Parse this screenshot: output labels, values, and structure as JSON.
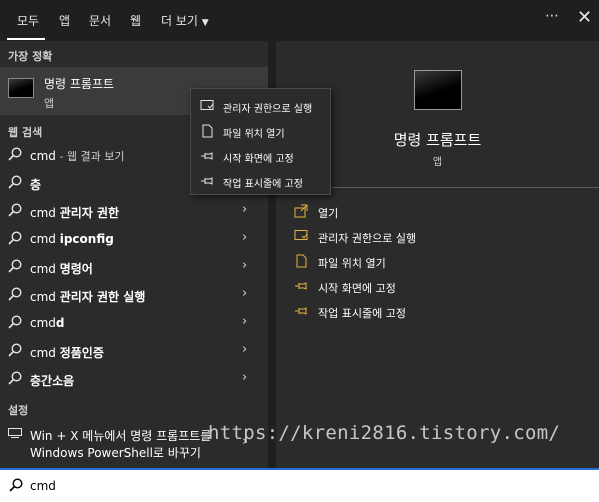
{
  "topbar": {
    "tabs": [
      "모두",
      "앱",
      "문서",
      "웹",
      "더 보기"
    ],
    "more_label": "⋯",
    "close_label": "✕"
  },
  "left": {
    "best_match_header": "가장 정확",
    "best_match": {
      "title": "명령 프롬프트",
      "subtitle": "앱"
    },
    "web_header": "웹 검색",
    "web_items": [
      {
        "prefix": "cmd",
        "dim": " - 웹 결과 보기",
        "bold": "",
        "chevron": false
      },
      {
        "prefix": "",
        "dim": "",
        "bold": "층",
        "chevron": false
      },
      {
        "prefix": "cmd ",
        "dim": "",
        "bold": "관리자 권한",
        "chevron": true
      },
      {
        "prefix": "cmd ",
        "dim": "",
        "bold": "ipconfig",
        "chevron": true
      },
      {
        "prefix": "cmd ",
        "dim": "",
        "bold": "명령어",
        "chevron": true
      },
      {
        "prefix": "cmd ",
        "dim": "",
        "bold": "관리자 권한 실행",
        "chevron": true
      },
      {
        "prefix": "cmd",
        "dim": "",
        "bold": "d",
        "chevron": true
      },
      {
        "prefix": "cmd ",
        "dim": "",
        "bold": "정품인증",
        "chevron": true
      },
      {
        "prefix": "",
        "dim": "",
        "bold": "층간소음",
        "chevron": true
      }
    ],
    "settings_header": "설정",
    "settings_item": {
      "line1": "Win + X 메뉴에서 명령 프롬프트를",
      "line2": "Windows PowerShell로 바꾸기"
    },
    "chevron": "›"
  },
  "right": {
    "title": "명령 프롬프트",
    "subtitle": "앱",
    "actions": [
      {
        "label": "열기",
        "icon": "open-icon"
      },
      {
        "label": "관리자 권한으로 실행",
        "icon": "shield-run-icon"
      },
      {
        "label": "파일 위치 열기",
        "icon": "file-location-icon"
      },
      {
        "label": "시작 화면에 고정",
        "icon": "pin-icon"
      },
      {
        "label": "작업 표시줄에 고정",
        "icon": "pin-icon"
      }
    ]
  },
  "context_menu": {
    "items": [
      {
        "label": "관리자 권한으로 실행",
        "icon": "shield-run-icon"
      },
      {
        "label": "파일 위치 열기",
        "icon": "file-location-icon"
      },
      {
        "label": "시작 화면에 고정",
        "icon": "pin-icon"
      },
      {
        "label": "작업 표시줄에 고정",
        "icon": "pin-icon"
      }
    ]
  },
  "search": {
    "value": "cmd"
  },
  "watermark": "https://kreni2816.tistory.com/",
  "colors": {
    "accent": "#2b6cd4",
    "icon_accent": "#e8b53c"
  }
}
